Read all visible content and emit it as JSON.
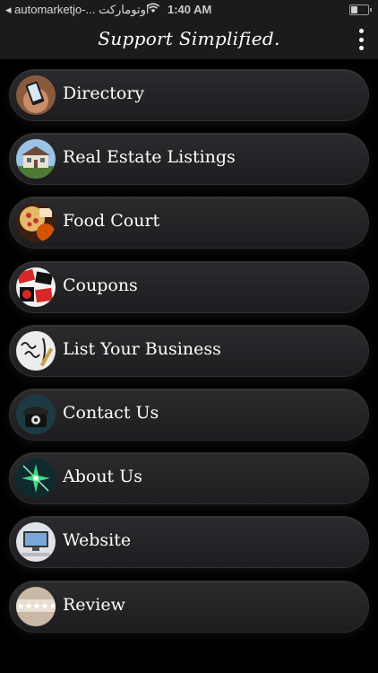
{
  "status_bar": {
    "back_text": "◂ automarketjo-... اوتومارکت",
    "time": "1:40 AM",
    "battery_level": 0.4
  },
  "header": {
    "title": "Support Simplified.",
    "menu_icon": "kebab-menu-icon"
  },
  "menu": [
    {
      "label": "Directory",
      "icon": "phone-in-hand-thumbnail"
    },
    {
      "label": "Real Estate Listings",
      "icon": "house-thumbnail"
    },
    {
      "label": "Food Court",
      "icon": "pizza-thumbnail"
    },
    {
      "label": "Coupons",
      "icon": "sale-tags-thumbnail"
    },
    {
      "label": "List Your Business",
      "icon": "sign-up-thumbnail"
    },
    {
      "label": "Contact Us",
      "icon": "telephone-thumbnail"
    },
    {
      "label": "About Us",
      "icon": "sparkle-thumbnail"
    },
    {
      "label": "Website",
      "icon": "computer-thumbnail"
    },
    {
      "label": "Review",
      "icon": "stars-thumbnail"
    }
  ]
}
